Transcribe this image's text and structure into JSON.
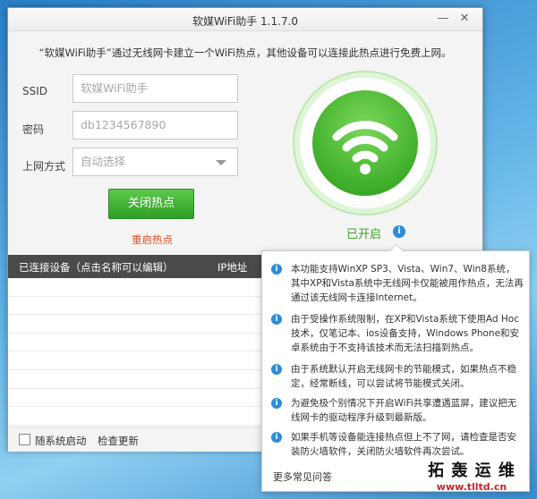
{
  "window": {
    "title": "软媒WiFi助手 1.1.7.0",
    "minimize_glyph": "—",
    "close_glyph": "✕",
    "description": "“软媒WiFi助手”通过无线网卡建立一个WiFi热点，其他设备可以连接此热点进行免费上网。"
  },
  "form": {
    "ssid_label": "SSID",
    "ssid_value": "软媒WiFi助手",
    "password_label": "密码",
    "password_value": "db1234567890",
    "method_label": "上网方式",
    "method_value": "自动选择"
  },
  "actions": {
    "close_hotspot_label": "关闭热点",
    "restart_hotspot_label": "重启热点"
  },
  "status": {
    "text": "已开启",
    "info_glyph": "i",
    "accent_color": "#3aa41f"
  },
  "devices": {
    "col_name": "已连接设备（点击名称可以编辑）",
    "col_ip": "IP地址"
  },
  "footer": {
    "autostart_label": "随系统启动",
    "check_update_label": "检查更新"
  },
  "popup": {
    "tips": [
      "本功能支持WinXP SP3、Vista、Win7、Win8系统，其中XP和Vista系统中无线网卡仅能被用作热点，无法再通过该无线网卡连接Internet。",
      "由于受操作系统限制，在XP和Vista系统下使用Ad Hoc技术，仅笔记本、ios设备支持，Windows Phone和安卓系统由于不支持该技术而无法扫描到热点。",
      "由于系统默认开启无线网卡的节能模式，如果热点不稳定，经常断线，可以尝试将节能模式关闭。",
      "为避免极个别情况下开启WiFi共享遭遇蓝屏，建议把无线网卡的驱动程序升级到最新版。",
      "如果手机等设备能连接热点但上不了网，请检查是否安装防火墙软件，关闭防火墙软件再次尝试。"
    ],
    "more_faq": "更多常见问答"
  },
  "watermark": {
    "text": "拓 轰 运 维",
    "url": "www.tlltd.cn"
  }
}
